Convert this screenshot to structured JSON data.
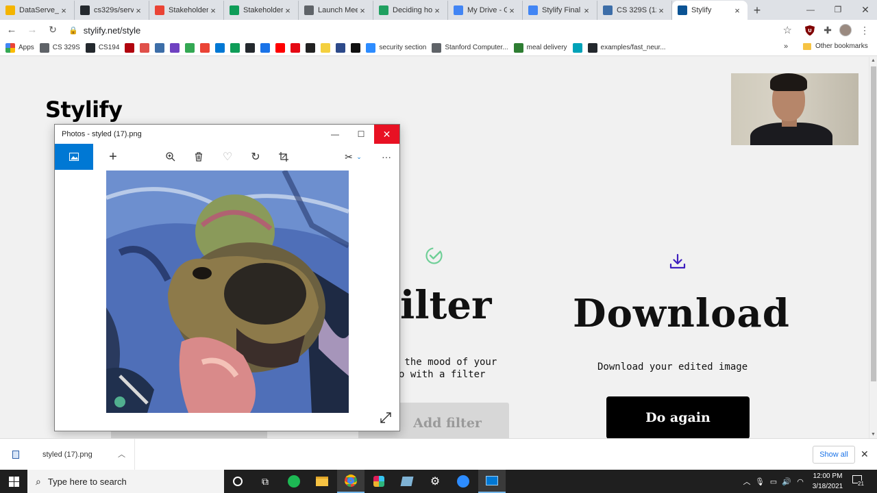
{
  "browser": {
    "tabs": [
      {
        "label": "DataServe_P",
        "color": "#f4b400",
        "icon_name": "slides-icon"
      },
      {
        "label": "cs329s/serve",
        "color": "#24292e",
        "icon_name": "github-icon"
      },
      {
        "label": "Stakeholder",
        "color": "#ea4335",
        "icon_name": "gmail-icon"
      },
      {
        "label": "Stakeholder",
        "color": "#0f9d58",
        "icon_name": "drive-icon"
      },
      {
        "label": "Launch Mee",
        "color": "#5f6368",
        "icon_name": "globe-icon"
      },
      {
        "label": "Deciding ho",
        "color": "#20a060",
        "icon_name": "techcrunch-icon"
      },
      {
        "label": "My Drive - G",
        "color": "#4285f4",
        "icon_name": "drive-icon"
      },
      {
        "label": "Stylify Final",
        "color": "#4285f4",
        "icon_name": "docs-icon"
      },
      {
        "label": "CS 329S (12",
        "color": "#3d6ea8",
        "icon_name": "piazza-icon"
      },
      {
        "label": "Stylify",
        "color": "#0b5394",
        "icon_name": "react-icon"
      }
    ],
    "active_tab_index": 9,
    "url": "stylify.net/style",
    "bookmarks": [
      {
        "label": "Apps",
        "color": "#e8453c"
      },
      {
        "label": "CS 329S",
        "color": "#5f6368"
      },
      {
        "label": "CS194",
        "color": "#24292e"
      },
      {
        "label": "",
        "color": "#b1040e"
      },
      {
        "label": "",
        "color": "#e0504a"
      },
      {
        "label": "",
        "color": "#3d6ea8"
      },
      {
        "label": "",
        "color": "#6f42c1"
      },
      {
        "label": "",
        "color": "#34a853"
      },
      {
        "label": "",
        "color": "#ea4335"
      },
      {
        "label": "",
        "color": "#0078d4"
      },
      {
        "label": "",
        "color": "#0f9d58"
      },
      {
        "label": "",
        "color": "#24292e"
      },
      {
        "label": "",
        "color": "#1a73e8"
      },
      {
        "label": "",
        "color": "#ff0000"
      },
      {
        "label": "",
        "color": "#e50914"
      },
      {
        "label": "",
        "color": "#222222"
      },
      {
        "label": "",
        "color": "#f4d03f"
      },
      {
        "label": "",
        "color": "#2d4a8a"
      },
      {
        "label": "",
        "color": "#111111"
      },
      {
        "label": "security section",
        "color": "#2d8cff"
      },
      {
        "label": "Stanford Computer...",
        "color": "#5f6368"
      },
      {
        "label": "meal delivery",
        "color": "#2e7d32"
      },
      {
        "label": "",
        "color": "#00a2b8"
      },
      {
        "label": "examples/fast_neur...",
        "color": "#24292e"
      }
    ],
    "other_bookmarks": "Other bookmarks",
    "overflow": "»"
  },
  "site": {
    "brand": "Stylify",
    "filter_heading": "ilter",
    "filter_desc": " the mood of your\no with a filter",
    "add_filter_button": "Add filter",
    "download_heading": "Download",
    "download_desc": "Download your edited image",
    "do_again_button": "Do again",
    "accent_green": "#6fcf97",
    "accent_purple": "#3f1fbf"
  },
  "photos_window": {
    "title": "Photos - styled (17).png",
    "tools": [
      "add-icon",
      "zoom-icon",
      "delete-icon",
      "favorite-icon",
      "rotate-icon",
      "crop-icon",
      "edit-icon",
      "more-icon"
    ],
    "more_label": "···"
  },
  "download_shelf": {
    "filename": "styled (17).png",
    "show_all": "Show all"
  },
  "taskbar": {
    "search_placeholder": "Type here to search",
    "time": "12:00 PM",
    "date": "3/18/2021",
    "notification_count": "21"
  }
}
